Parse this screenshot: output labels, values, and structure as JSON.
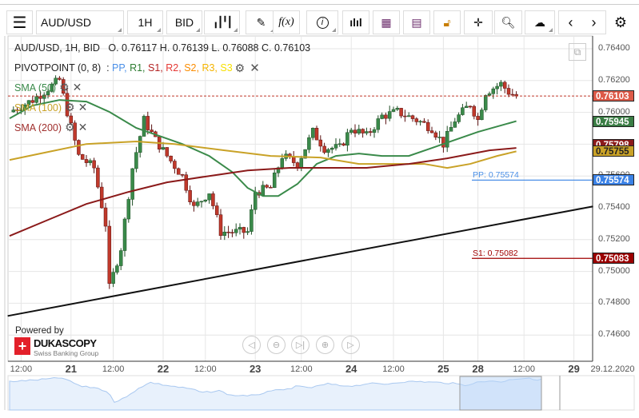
{
  "toolbar": {
    "menu_icon": "hamburger-icon",
    "symbol": "AUD/USD",
    "timeframe": "1H",
    "side": "BID",
    "icons": [
      "candlestick-icon",
      "pencil-icon",
      "function-icon",
      "info-icon",
      "bar-chart-icon",
      "calendar-icon",
      "news-icon",
      "lock-icon",
      "crosshair-icon",
      "zoom-chart-icon",
      "cloud-upload-icon",
      "chevron-left-icon",
      "chevron-right-icon",
      "gear-icon"
    ],
    "fx_label": "f(x)"
  },
  "legend": {
    "title": "AUD/USD, 1H, BID",
    "ohlc": "O. 0.76117 H. 0.76139 L. 0.76088 C. 0.76103",
    "pivot": "PIVOTPOINT (0, 8)",
    "pivot_sep": ":",
    "pivot_items": [
      {
        "label": "PP",
        "color": "#4a8fe7"
      },
      {
        "label": "R1",
        "color": "#2e7d32"
      },
      {
        "label": "S1",
        "color": "#b22222"
      },
      {
        "label": "R2",
        "color": "#e53935"
      },
      {
        "label": "S2",
        "color": "#fb8c00"
      },
      {
        "label": "R3",
        "color": "#f4b400"
      },
      {
        "label": "S3",
        "color": "#f7e000"
      }
    ]
  },
  "indicators": [
    {
      "label": "SMA (50)",
      "color": "#3a8a4a"
    },
    {
      "label": "SMA (100)",
      "color": "#c9a227"
    },
    {
      "label": "SMA (200)",
      "color": "#a0302e"
    }
  ],
  "chart_data": {
    "type": "candlestick",
    "symbol": "AUD/USD",
    "ylim": [
      0.7456,
      0.7646
    ],
    "price_ticks": [
      "0.76400",
      "0.76200",
      "0.76000",
      "0.75800",
      "0.75600",
      "0.75400",
      "0.75200",
      "0.75000",
      "0.74800",
      "0.74600"
    ],
    "time_ticks": [
      {
        "label": "12:00",
        "h": 3,
        "day": false
      },
      {
        "label": "21",
        "h": 16,
        "day": true
      },
      {
        "label": "12:00",
        "h": 27,
        "day": false
      },
      {
        "label": "22",
        "h": 40,
        "day": true
      },
      {
        "label": "12:00",
        "h": 51,
        "day": false
      },
      {
        "label": "23",
        "h": 64,
        "day": true
      },
      {
        "label": "12:00",
        "h": 76,
        "day": false
      },
      {
        "label": "24",
        "h": 89,
        "day": true
      },
      {
        "label": "12:00",
        "h": 100,
        "day": false
      },
      {
        "label": "25",
        "h": 113,
        "day": true
      },
      {
        "label": "28",
        "h": 122,
        "day": true
      },
      {
        "label": "12:00",
        "h": 134,
        "day": false
      },
      {
        "label": "29",
        "h": 147,
        "day": true
      }
    ],
    "end_date": "29.12.2020",
    "close_keypoints": [
      [
        0,
        0.76003
      ],
      [
        6,
        0.76078
      ],
      [
        13,
        0.76204
      ],
      [
        15,
        0.76003
      ],
      [
        18,
        0.75726
      ],
      [
        22,
        0.75651
      ],
      [
        25,
        0.75298
      ],
      [
        26,
        0.74896
      ],
      [
        29,
        0.75148
      ],
      [
        32,
        0.7565
      ],
      [
        35,
        0.75952
      ],
      [
        38,
        0.75827
      ],
      [
        41,
        0.75726
      ],
      [
        45,
        0.756
      ],
      [
        48,
        0.75399
      ],
      [
        52,
        0.755
      ],
      [
        55,
        0.75248
      ],
      [
        58,
        0.75248
      ],
      [
        62,
        0.75248
      ],
      [
        64,
        0.755
      ],
      [
        68,
        0.75525
      ],
      [
        71,
        0.75726
      ],
      [
        75,
        0.75676
      ],
      [
        79,
        0.75877
      ],
      [
        82,
        0.75776
      ],
      [
        86,
        0.75776
      ],
      [
        89,
        0.75902
      ],
      [
        93,
        0.75852
      ],
      [
        97,
        0.75977
      ],
      [
        101,
        0.76003
      ],
      [
        106,
        0.75952
      ],
      [
        110,
        0.75902
      ],
      [
        113,
        0.75801
      ],
      [
        116,
        0.75952
      ],
      [
        120,
        0.76053
      ],
      [
        122,
        0.75952
      ],
      [
        124,
        0.76128
      ],
      [
        128,
        0.76179
      ],
      [
        130,
        0.76128
      ],
      [
        132,
        0.76103
      ]
    ],
    "sma50": [
      [
        0,
        0.75962
      ],
      [
        6,
        0.76043
      ],
      [
        13,
        0.76078
      ],
      [
        20,
        0.76068
      ],
      [
        26,
        0.76003
      ],
      [
        33,
        0.75902
      ],
      [
        39,
        0.75852
      ],
      [
        45,
        0.75801
      ],
      [
        52,
        0.75726
      ],
      [
        58,
        0.75625
      ],
      [
        62,
        0.75525
      ],
      [
        66,
        0.75474
      ],
      [
        70,
        0.75474
      ],
      [
        75,
        0.7555
      ],
      [
        80,
        0.75676
      ],
      [
        85,
        0.75726
      ],
      [
        91,
        0.75741
      ],
      [
        97,
        0.75726
      ],
      [
        104,
        0.75726
      ],
      [
        110,
        0.75776
      ],
      [
        116,
        0.75827
      ],
      [
        122,
        0.75877
      ],
      [
        132,
        0.75945
      ]
    ],
    "sma100": [
      [
        0,
        0.75701
      ],
      [
        10,
        0.75751
      ],
      [
        20,
        0.75801
      ],
      [
        33,
        0.75817
      ],
      [
        43,
        0.75801
      ],
      [
        56,
        0.75761
      ],
      [
        68,
        0.75726
      ],
      [
        81,
        0.75716
      ],
      [
        91,
        0.75676
      ],
      [
        100,
        0.75676
      ],
      [
        108,
        0.75676
      ],
      [
        114,
        0.75651
      ],
      [
        120,
        0.75676
      ],
      [
        127,
        0.75726
      ],
      [
        132,
        0.75755
      ]
    ],
    "sma200": [
      [
        0,
        0.75223
      ],
      [
        10,
        0.75324
      ],
      [
        20,
        0.75424
      ],
      [
        31,
        0.755
      ],
      [
        41,
        0.7556
      ],
      [
        52,
        0.756
      ],
      [
        62,
        0.75635
      ],
      [
        73,
        0.75651
      ],
      [
        83,
        0.75651
      ],
      [
        93,
        0.75651
      ],
      [
        104,
        0.75676
      ],
      [
        114,
        0.75711
      ],
      [
        125,
        0.75761
      ],
      [
        132,
        0.75776
      ]
    ],
    "trendline": [
      [
        -0.5,
        0.7472
      ],
      [
        152,
        0.75409
      ]
    ],
    "last_price": "0.76103",
    "last_price_value": 0.76103,
    "badges": [
      {
        "text": "0.75798",
        "value": 0.75795,
        "color": "#8b1a1a"
      },
      {
        "text": "0.76103",
        "value": 0.76103,
        "color": "#dd5a48"
      },
      {
        "text": "0.75945",
        "value": 0.75945,
        "color": "#3a7d44"
      },
      {
        "text": "0.75755",
        "value": 0.75755,
        "color": "#c9a227",
        "dark": true
      },
      {
        "text": "0.75574",
        "value": 0.75574,
        "color": "#3b82e6"
      },
      {
        "text": "0.75083",
        "value": 0.75083,
        "color": "#9b0000"
      }
    ],
    "pivots": [
      {
        "label": "PP: 0.75574",
        "value": 0.75574,
        "color": "#4a8fe7"
      },
      {
        "label": "S1: 0.75082",
        "value": 0.75082,
        "color": "#a00000"
      }
    ]
  },
  "branding": {
    "powered_by": "Powered by",
    "brand": "DUKASCOPY",
    "tagline": "Swiss Banking Group"
  },
  "navigation": [
    "scroll-left-icon",
    "zoom-out-icon",
    "go-to-end-icon",
    "zoom-in-icon",
    "scroll-right-icon"
  ]
}
